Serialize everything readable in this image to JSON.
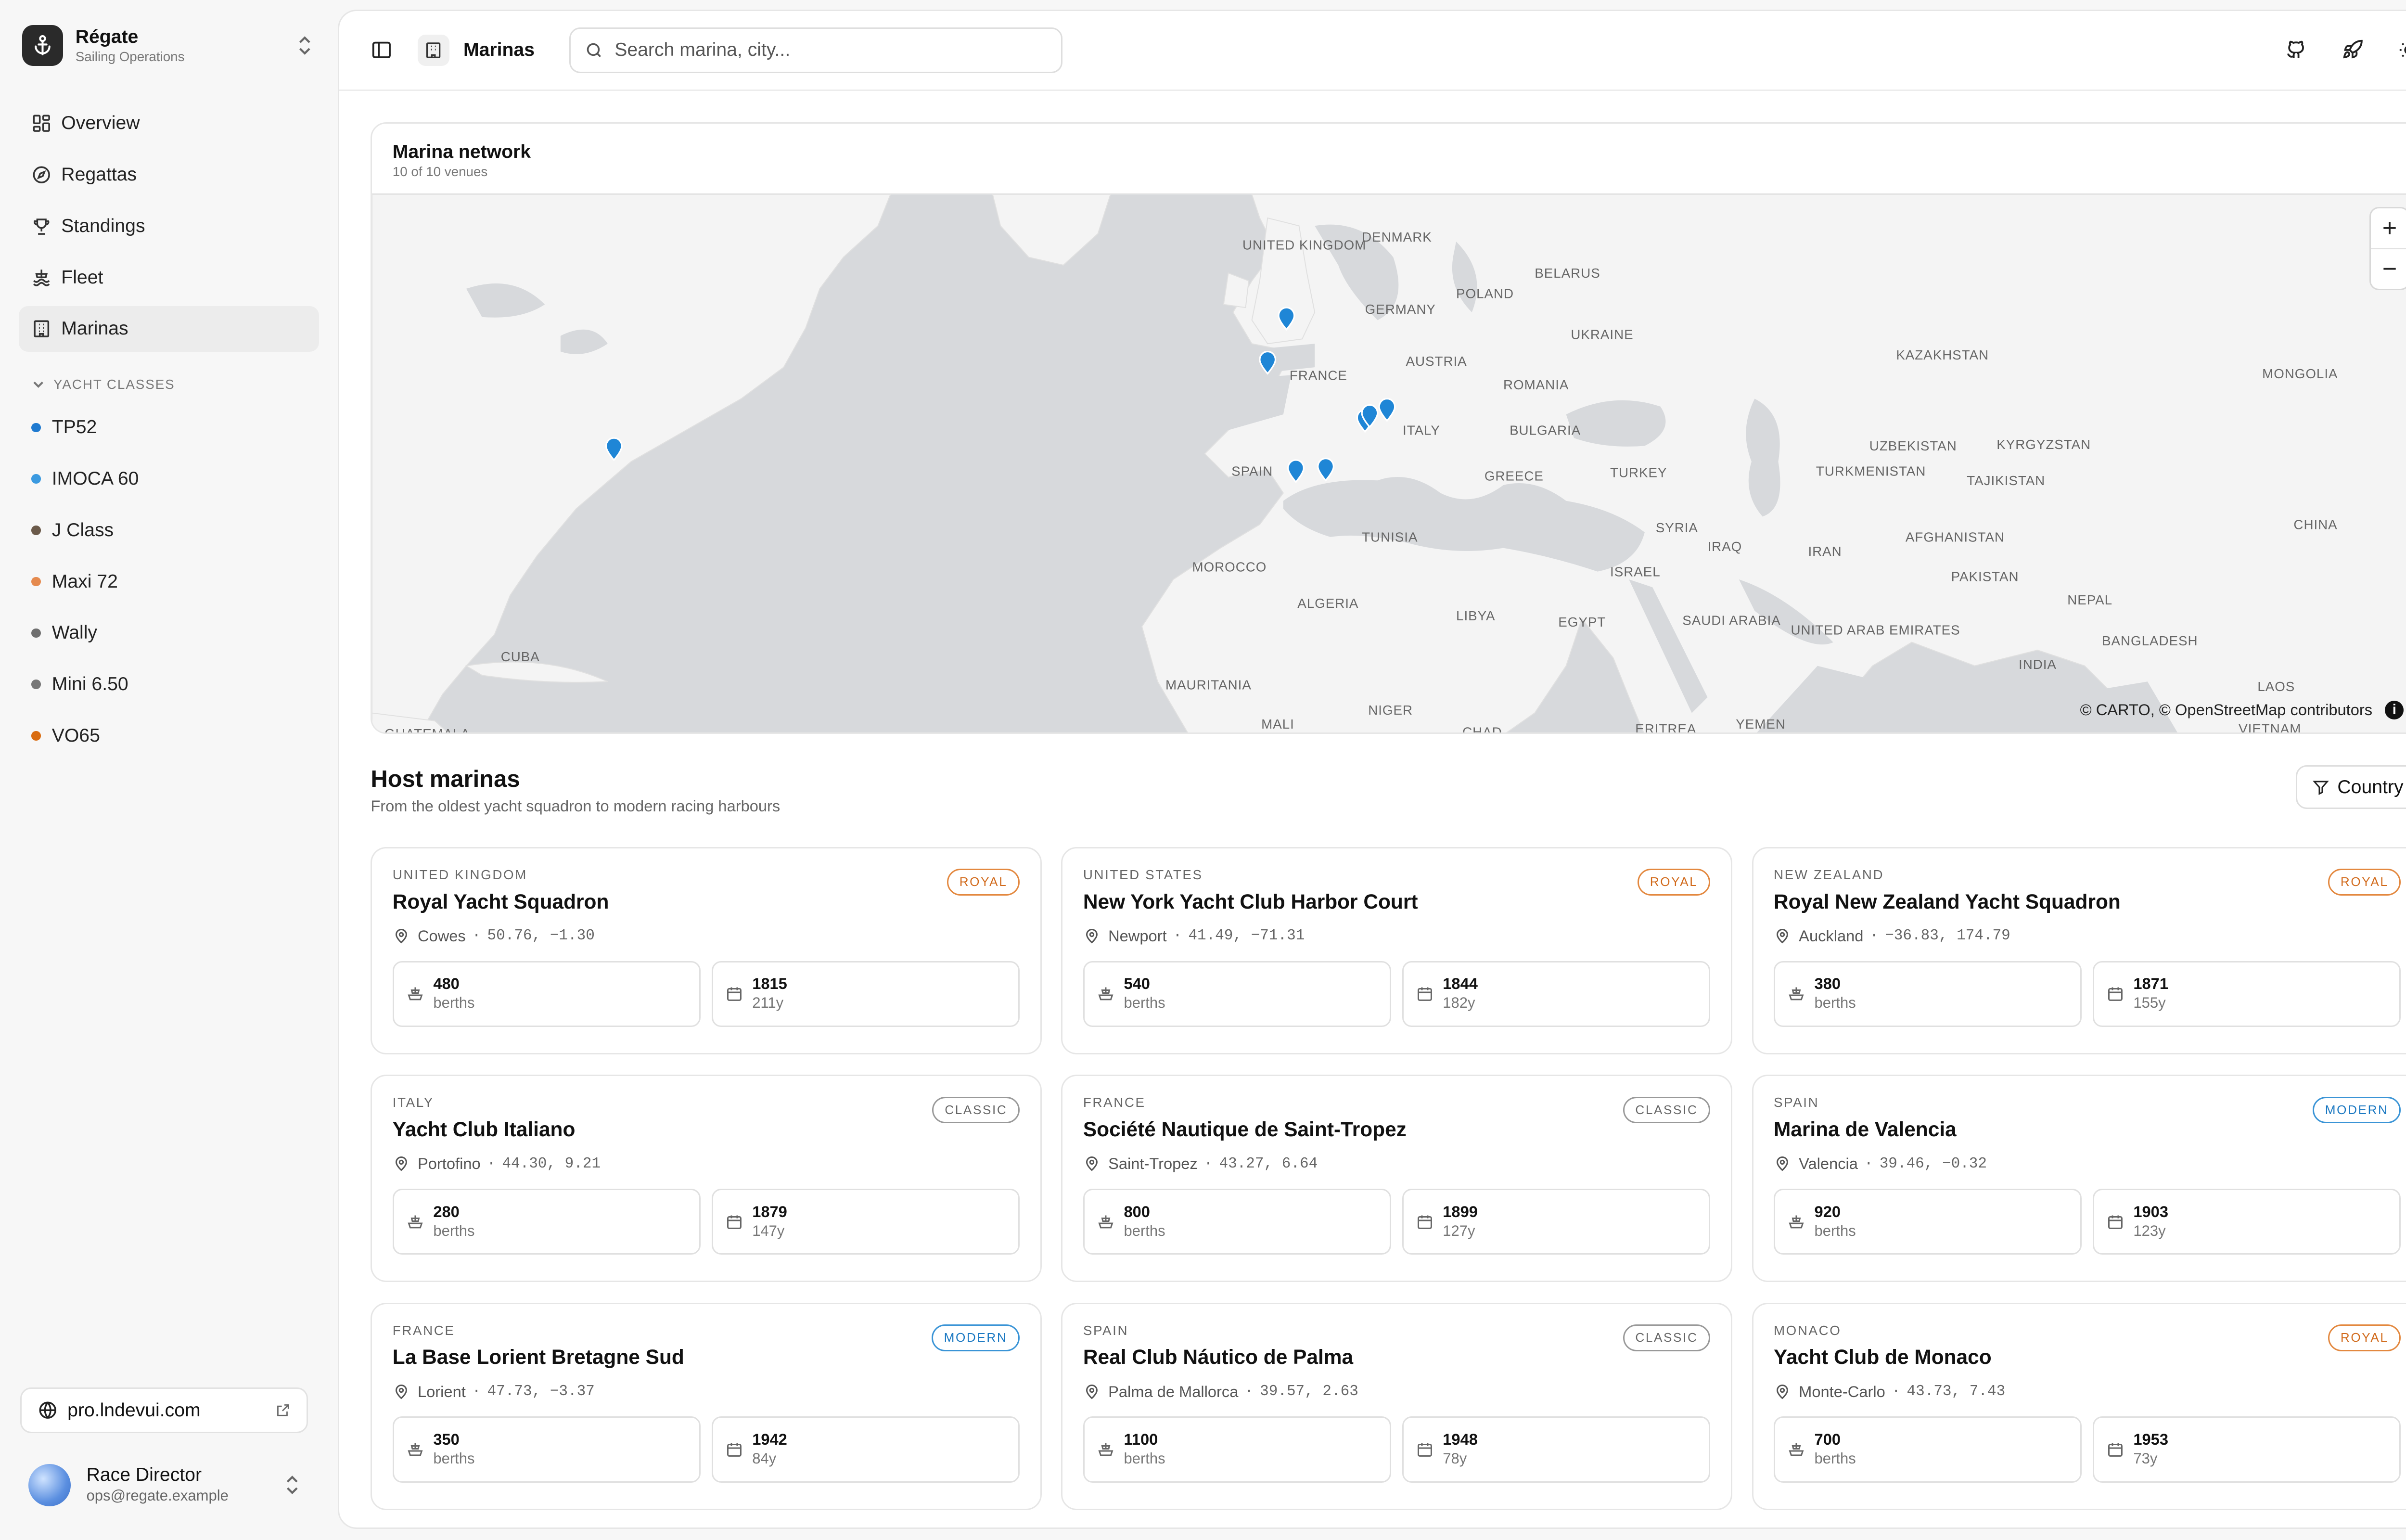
{
  "brand": {
    "name": "Régate",
    "subtitle": "Sailing Operations"
  },
  "nav": [
    {
      "label": "Overview",
      "icon": "grid-icon"
    },
    {
      "label": "Regattas",
      "icon": "compass-icon"
    },
    {
      "label": "Standings",
      "icon": "trophy-icon"
    },
    {
      "label": "Fleet",
      "icon": "ship-icon"
    },
    {
      "label": "Marinas",
      "icon": "building-icon",
      "active": true
    }
  ],
  "yacht_classes": {
    "label": "YACHT CLASSES",
    "items": [
      {
        "label": "TP52",
        "color": "#1f7ad0"
      },
      {
        "label": "IMOCA 60",
        "color": "#3b9ae0"
      },
      {
        "label": "J Class",
        "color": "#6b5a4a"
      },
      {
        "label": "Maxi 72",
        "color": "#e58a4e"
      },
      {
        "label": "Wally",
        "color": "#6f6f6f"
      },
      {
        "label": "Mini 6.50",
        "color": "#777777"
      },
      {
        "label": "VO65",
        "color": "#d96c10"
      }
    ]
  },
  "site_link": "pro.lndevui.com",
  "user": {
    "name": "Race Director",
    "email": "ops@regate.example"
  },
  "topbar": {
    "breadcrumb": "Marinas",
    "search_placeholder": "Search marina, city..."
  },
  "map": {
    "title": "Marina network",
    "subtitle": "10 of 10 venues",
    "attribution": "© CARTO, © OpenStreetMap contributors",
    "zoom_in": "+",
    "zoom_out": "−",
    "labels": {
      "uk": "UNITED KINGDOM",
      "denmark": "DENMARK",
      "belarus": "BELARUS",
      "poland": "POLAND",
      "germany": "GERMANY",
      "ukraine": "UKRAINE",
      "kazakhstan": "KAZAKHSTAN",
      "mongolia": "MONGOLIA",
      "france": "FRANCE",
      "austria": "AUSTRIA",
      "romania": "ROMANIA",
      "bulgaria": "BULGARIA",
      "italy": "ITALY",
      "uzbekistan": "UZBEKISTAN",
      "kyrgyzstan": "KYRGYZSTAN",
      "turkmenistan": "TURKMENISTAN",
      "tajikistan": "TAJIKISTAN",
      "spain": "SPAIN",
      "greece": "GREECE",
      "turkey": "TURKEY",
      "syria": "SYRIA",
      "iraq": "IRAQ",
      "china": "CHINA",
      "tunisia": "TUNISIA",
      "afghanistan": "AFGHANISTAN",
      "iran": "IRAN",
      "morocco": "MOROCCO",
      "israel": "ISRAEL",
      "pakistan": "PAKISTAN",
      "algeria": "ALGERIA",
      "libya": "LIBYA",
      "nepal": "NEPAL",
      "egypt": "EGYPT",
      "saudi_arabia": "SAUDI ARABIA",
      "uae": "UNITED ARAB EMIRATES",
      "bangladesh": "BANGLADESH",
      "cuba": "CUBA",
      "india": "INDIA",
      "mauritania": "MAURITANIA",
      "niger": "NIGER",
      "laos": "LAOS",
      "mali": "MALI",
      "guatemala": "GUATEMALA",
      "chad": "CHAD",
      "eritrea": "ERITREA",
      "yemen": "YEMEN",
      "vietnam": "VIETNAM"
    }
  },
  "host_marinas": {
    "title": "Host marinas",
    "subtitle": "From the oldest yacht squadron to modern racing harbours",
    "filter_label": "Country",
    "items": [
      {
        "country": "UNITED KINGDOM",
        "name": "Royal Yacht Squadron",
        "city": "Cowes",
        "coords": "50.76, −1.30",
        "badge": "ROYAL",
        "berths": "480",
        "berths_label": "berths",
        "year": "1815",
        "age": "211y"
      },
      {
        "country": "UNITED STATES",
        "name": "New York Yacht Club Harbor Court",
        "city": "Newport",
        "coords": "41.49, −71.31",
        "badge": "ROYAL",
        "berths": "540",
        "berths_label": "berths",
        "year": "1844",
        "age": "182y"
      },
      {
        "country": "NEW ZEALAND",
        "name": "Royal New Zealand Yacht Squadron",
        "city": "Auckland",
        "coords": "−36.83, 174.79",
        "badge": "ROYAL",
        "berths": "380",
        "berths_label": "berths",
        "year": "1871",
        "age": "155y"
      },
      {
        "country": "ITALY",
        "name": "Yacht Club Italiano",
        "city": "Portofino",
        "coords": "44.30, 9.21",
        "badge": "CLASSIC",
        "berths": "280",
        "berths_label": "berths",
        "year": "1879",
        "age": "147y"
      },
      {
        "country": "FRANCE",
        "name": "Société Nautique de Saint-Tropez",
        "city": "Saint-Tropez",
        "coords": "43.27, 6.64",
        "badge": "CLASSIC",
        "berths": "800",
        "berths_label": "berths",
        "year": "1899",
        "age": "127y"
      },
      {
        "country": "SPAIN",
        "name": "Marina de Valencia",
        "city": "Valencia",
        "coords": "39.46, −0.32",
        "badge": "MODERN",
        "berths": "920",
        "berths_label": "berths",
        "year": "1903",
        "age": "123y"
      },
      {
        "country": "FRANCE",
        "name": "La Base Lorient Bretagne Sud",
        "city": "Lorient",
        "coords": "47.73, −3.37",
        "badge": "MODERN",
        "berths": "350",
        "berths_label": "berths",
        "year": "1942",
        "age": "84y"
      },
      {
        "country": "SPAIN",
        "name": "Real Club Náutico de Palma",
        "city": "Palma de Mallorca",
        "coords": "39.57, 2.63",
        "badge": "CLASSIC",
        "berths": "1100",
        "berths_label": "berths",
        "year": "1948",
        "age": "78y"
      },
      {
        "country": "MONACO",
        "name": "Yacht Club de Monaco",
        "city": "Monte-Carlo",
        "coords": "43.73, 7.43",
        "badge": "ROYAL",
        "berths": "700",
        "berths_label": "berths",
        "year": "1953",
        "age": "73y"
      }
    ]
  },
  "colors": {
    "marker": "#1f86d6",
    "royal": "#d1691a",
    "modern": "#1a78c2",
    "classic": "#666666"
  }
}
